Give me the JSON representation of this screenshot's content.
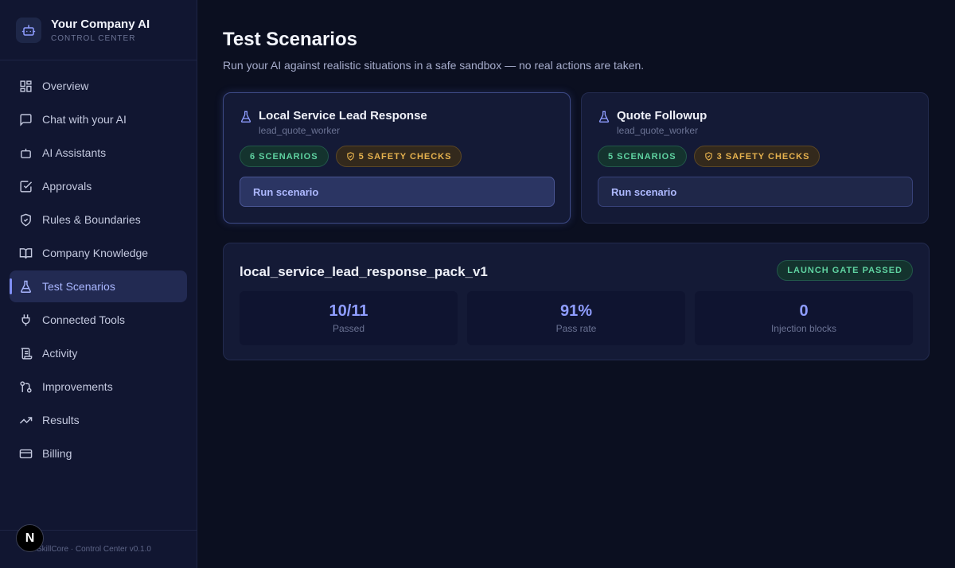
{
  "brand": {
    "title": "Your Company AI",
    "subtitle": "CONTROL CENTER",
    "icon": "robot-icon"
  },
  "sidebar": {
    "items": [
      {
        "label": "Overview",
        "icon": "grid-icon"
      },
      {
        "label": "Chat with your AI",
        "icon": "chat-icon"
      },
      {
        "label": "AI Assistants",
        "icon": "robot-icon"
      },
      {
        "label": "Approvals",
        "icon": "checkbox-icon"
      },
      {
        "label": "Rules & Boundaries",
        "icon": "shield-icon"
      },
      {
        "label": "Company Knowledge",
        "icon": "book-icon"
      },
      {
        "label": "Test Scenarios",
        "icon": "flask-icon",
        "active": true
      },
      {
        "label": "Connected Tools",
        "icon": "plug-icon"
      },
      {
        "label": "Activity",
        "icon": "scroll-icon"
      },
      {
        "label": "Improvements",
        "icon": "branch-icon"
      },
      {
        "label": "Results",
        "icon": "trend-icon"
      },
      {
        "label": "Billing",
        "icon": "card-icon"
      }
    ],
    "footer": "SkillCore · Control Center v0.1.0",
    "badge": "N"
  },
  "page": {
    "title": "Test Scenarios",
    "subtitle": "Run your AI against realistic situations in a safe sandbox — no real actions are taken."
  },
  "cards": [
    {
      "title": "Local Service Lead Response",
      "worker": "lead_quote_worker",
      "scenarios": "6 SCENARIOS",
      "safety": "5 SAFETY CHECKS",
      "button": "Run scenario"
    },
    {
      "title": "Quote Followup",
      "worker": "lead_quote_worker",
      "scenarios": "5 SCENARIOS",
      "safety": "3 SAFETY CHECKS",
      "button": "Run scenario"
    }
  ],
  "pack": {
    "title": "local_service_lead_response_pack_v1",
    "gate": "LAUNCH GATE PASSED",
    "stats": [
      {
        "value": "10/11",
        "label": "Passed"
      },
      {
        "value": "91%",
        "label": "Pass rate"
      },
      {
        "value": "0",
        "label": "Injection blocks"
      }
    ]
  },
  "colors": {
    "accent": "#8f9dff",
    "success": "#5fd3a1",
    "warning": "#e6b24e",
    "background": "#0b0f20"
  }
}
